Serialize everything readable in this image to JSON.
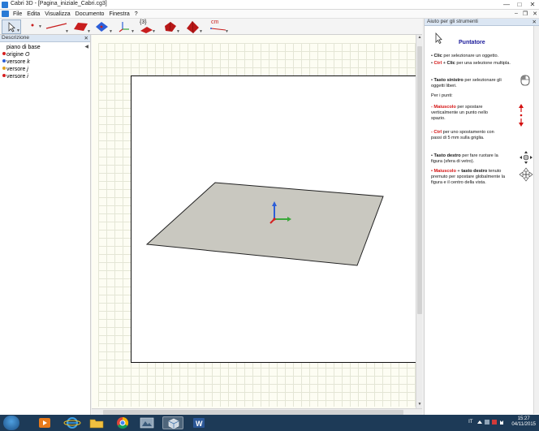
{
  "window": {
    "title": "Cabri 3D - [Pagina_iniziale_Cabri.cg3]",
    "controls": {
      "minimize": "—",
      "maximize": "□",
      "close": "✕"
    },
    "doc_controls": {
      "minimize": "–",
      "restore": "❐",
      "close": "✕"
    }
  },
  "menu": {
    "items": [
      "File",
      "Edita",
      "Visualizza",
      "Documento",
      "Finestra",
      "?"
    ]
  },
  "toolbar": {
    "tools": [
      "pointer-tool",
      "point-tool",
      "line-tool",
      "plane-tool",
      "polygon-tool",
      "axes-tool",
      "transform-tool",
      "polyhedron-tool",
      "cube-tool",
      "measure-tool"
    ],
    "label_13": "{3}",
    "label_cm": "cm",
    "accent": "#c81e1e"
  },
  "left_panel": {
    "title": "Descrizione",
    "close": "✕",
    "items": [
      {
        "text": "piano di base",
        "color": ""
      },
      {
        "text": "origine ",
        "italic": "O",
        "color": "#d62020"
      },
      {
        "text": "versore ",
        "italic": "k",
        "color": "#2c5ed8"
      },
      {
        "text": "versore ",
        "italic": "j",
        "color": "#3aa83a"
      },
      {
        "text": "versore ",
        "italic": "i",
        "color": "#d62020"
      }
    ]
  },
  "canvas": {
    "plane_color": "#c9c8c0",
    "axis_colors": {
      "i": "#d62020",
      "j": "#3aa83a",
      "k": "#2c5ed8"
    }
  },
  "help": {
    "title": "Aiuto per gli strumenti",
    "close": "✕",
    "heading": "Puntatore",
    "lines": {
      "l1_a": "• ",
      "l1_b": "Clic",
      "l1_c": " per selezionare un oggetto.",
      "l2_a": "• ",
      "l2_b": "Ctrl",
      "l2_c": " + ",
      "l2_d": "Clic",
      "l2_e": " per una selezione multipla.",
      "l3_a": "• ",
      "l3_b": "Tasto sinistro",
      "l3_c": " per selezionare gli oggetti liberi.",
      "l4": "Per i punti:",
      "l5_a": "- ",
      "l5_b": "Maiuscolo",
      "l5_c": " per spostare verticalmente un punto nello spazio.",
      "l6_a": "- ",
      "l6_b": "Ctrl",
      "l6_c": " per uno spostamento con passi di 5 mm sulla griglia.",
      "l7_a": "• ",
      "l7_b": "Tasto destro",
      "l7_c": " per fare ruotare la figura (sfera di vetro).",
      "l8_a": "• ",
      "l8_b": "Maiuscolo",
      "l8_c": " + ",
      "l8_d": "tasto destro",
      "l8_e": " tenuto premuto per spostare globalmente la figura e il centro della vista."
    }
  },
  "taskbar": {
    "apps": [
      "media-player",
      "internet-explorer",
      "file-explorer",
      "chrome",
      "app-4",
      "cabri-3d",
      "word"
    ],
    "language": "IT",
    "time": "15:27",
    "date": "04/11/2015"
  }
}
